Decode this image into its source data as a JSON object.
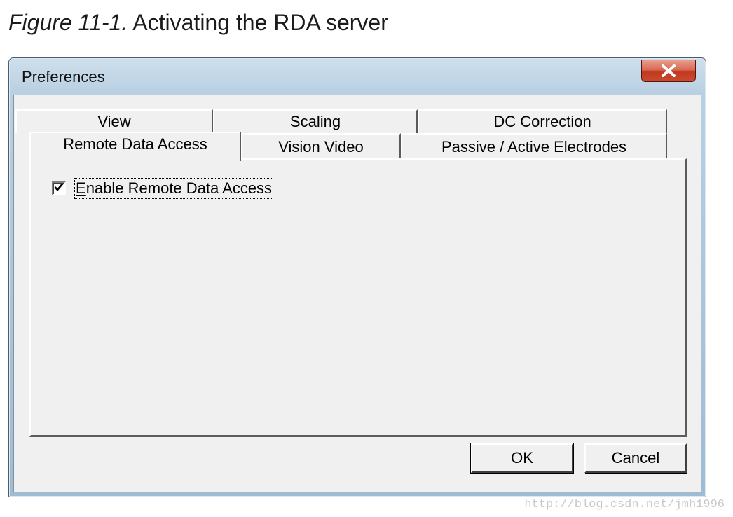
{
  "caption": {
    "figure_label": "Figure 11-1.",
    "text": "Activating the RDA server"
  },
  "window": {
    "title": "Preferences",
    "close_icon": "close-x-icon",
    "close_color": "#c94a31"
  },
  "tabs": {
    "row1": [
      "View",
      "Scaling",
      "DC Correction"
    ],
    "row2": [
      "Remote Data Access",
      "Vision Video",
      "Passive / Active Electrodes"
    ],
    "active": "Remote Data Access"
  },
  "remote_data_access": {
    "enable_checkbox": {
      "label_mnemonic": "E",
      "label_rest": "nable Remote Data Access",
      "checked": true
    }
  },
  "buttons": {
    "ok": "OK",
    "cancel": "Cancel"
  },
  "watermark": "http://blog.csdn.net/jmh1996"
}
